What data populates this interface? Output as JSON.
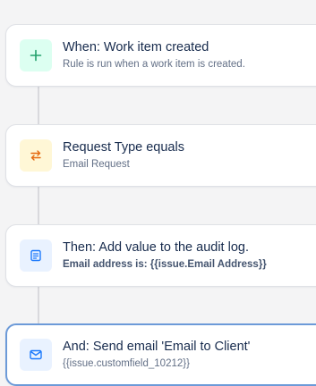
{
  "flow": {
    "steps": [
      {
        "title": "When: Work item created",
        "subtitle": "Rule is run when a work item is created.",
        "icon": "plus-icon",
        "accent": "#22a06b"
      },
      {
        "title": "Request Type equals",
        "subtitle": "Email Request",
        "icon": "swap-arrows-icon",
        "accent": "#e56910"
      },
      {
        "title": "Then: Add value to the audit log.",
        "subtitle": "Email address is: {{issue.Email Address}}",
        "icon": "document-icon",
        "accent": "#1d7afc"
      },
      {
        "title": "And: Send email 'Email to Client'",
        "subtitle": "{{issue.customfield_10212}}",
        "icon": "mail-icon",
        "accent": "#1d7afc"
      }
    ]
  }
}
